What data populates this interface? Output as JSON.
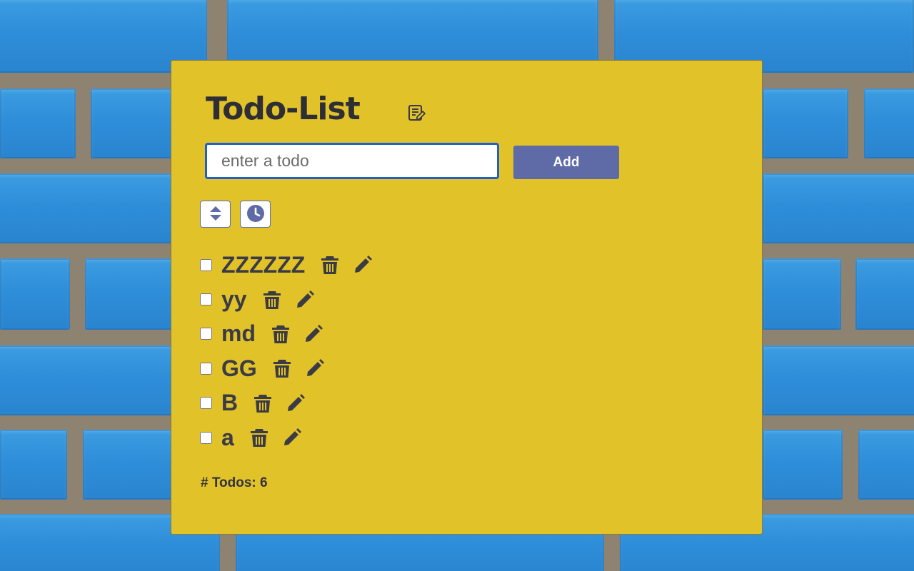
{
  "app": {
    "title": "Todo-List"
  },
  "form": {
    "input_placeholder": "enter a todo",
    "input_value": "",
    "add_label": "Add"
  },
  "controls": {
    "sort_icon": "sort-icon",
    "time_icon": "clock-icon"
  },
  "todos": [
    {
      "text": "ZZZZZZ",
      "done": false
    },
    {
      "text": "yy",
      "done": false
    },
    {
      "text": "md",
      "done": false
    },
    {
      "text": "GG",
      "done": false
    },
    {
      "text": "B",
      "done": false
    },
    {
      "text": "a",
      "done": false
    }
  ],
  "footer": {
    "count_label": "# Todos: 6"
  },
  "colors": {
    "card": "#e2c229",
    "accent": "#5f6ba6",
    "text": "#3b3b45",
    "input_border": "#1f5fd0",
    "wall_brick": "#2e8ed9",
    "wall_mortar": "#8e8270"
  }
}
